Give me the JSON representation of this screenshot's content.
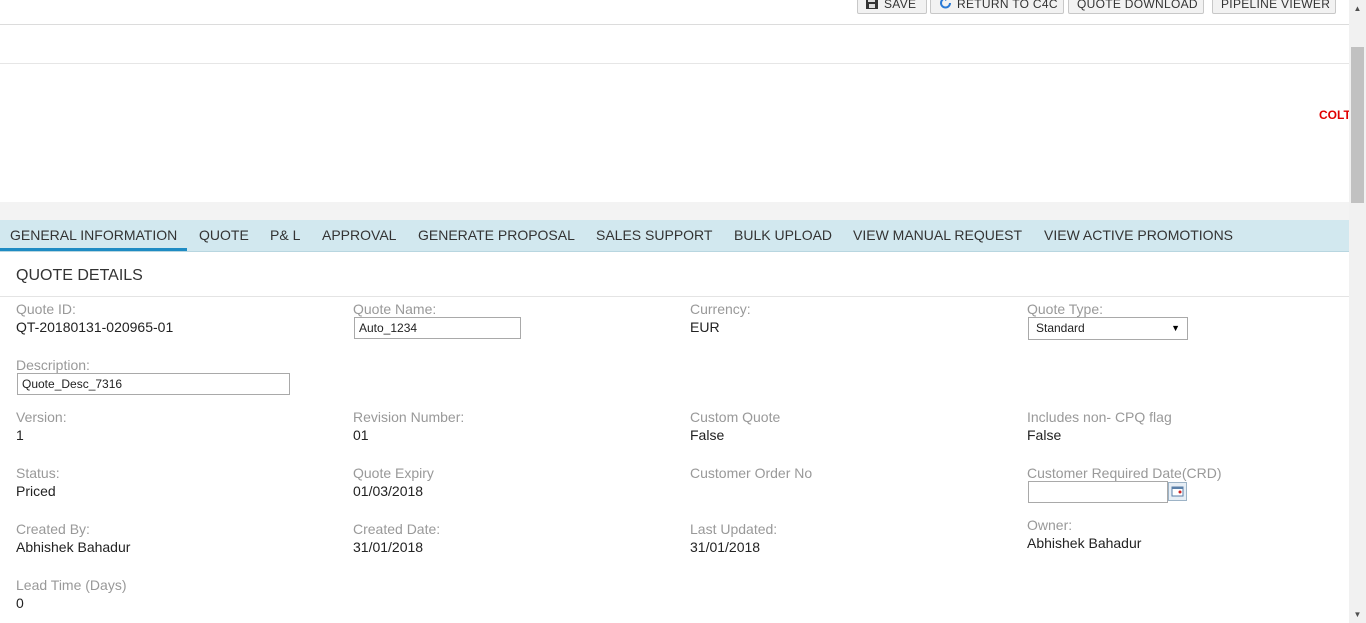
{
  "toolbar": {
    "save_label": "SAVE",
    "return_label": "RETURN TO C4C",
    "download_label": "QUOTE DOWNLOAD",
    "pipeline_label": "PIPELINE VIEWER"
  },
  "header": {
    "logo_text": "COLT"
  },
  "tabs": [
    {
      "label": "GENERAL INFORMATION",
      "active": true
    },
    {
      "label": "QUOTE"
    },
    {
      "label": "P& L"
    },
    {
      "label": "APPROVAL"
    },
    {
      "label": "GENERATE PROPOSAL"
    },
    {
      "label": "SALES SUPPORT"
    },
    {
      "label": "BULK UPLOAD"
    },
    {
      "label": "VIEW MANUAL REQUEST"
    },
    {
      "label": "VIEW ACTIVE PROMOTIONS"
    }
  ],
  "section": {
    "title": "QUOTE DETAILS"
  },
  "fields": {
    "quote_id": {
      "label": "Quote ID:",
      "value": "QT-20180131-020965-01"
    },
    "quote_name": {
      "label": "Quote Name:",
      "value": "Auto_1234"
    },
    "currency": {
      "label": "Currency:",
      "value": "EUR"
    },
    "quote_type": {
      "label": "Quote Type:",
      "value": "Standard"
    },
    "description": {
      "label": "Description:",
      "value": "Quote_Desc_7316"
    },
    "version": {
      "label": "Version:",
      "value": "1"
    },
    "revision": {
      "label": "Revision Number:",
      "value": "01"
    },
    "custom_quote": {
      "label": "Custom Quote",
      "value": "False"
    },
    "non_cpq": {
      "label": "Includes non- CPQ flag",
      "value": "False"
    },
    "status": {
      "label": "Status:",
      "value": "Priced"
    },
    "quote_expiry": {
      "label": "Quote Expiry",
      "value": "01/03/2018"
    },
    "customer_order": {
      "label": "Customer Order No",
      "value": ""
    },
    "crd": {
      "label": "Customer Required Date(CRD)",
      "value": ""
    },
    "created_by": {
      "label": "Created By:",
      "value": "Abhishek Bahadur"
    },
    "created_date": {
      "label": "Created Date:",
      "value": "31/01/2018"
    },
    "last_updated": {
      "label": "Last Updated:",
      "value": "31/01/2018"
    },
    "owner": {
      "label": "Owner:",
      "value": "Abhishek Bahadur"
    },
    "lead_time": {
      "label": "Lead Time (Days)",
      "value": "0"
    }
  },
  "icons": {
    "save": "floppy-disk-icon",
    "return": "refresh-arrow-icon",
    "calendar": "calendar-icon",
    "dropdown": "dropdown-arrow-icon"
  }
}
